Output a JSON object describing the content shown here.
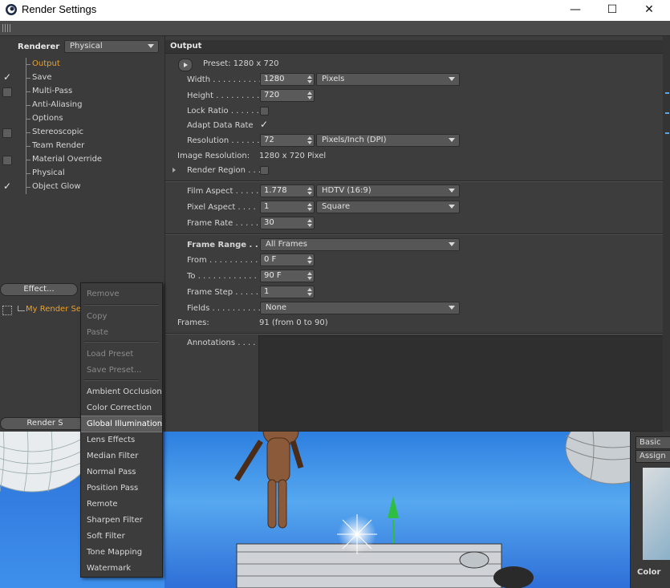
{
  "window": {
    "title": "Render Settings",
    "minimize": "—",
    "maximize": "☐",
    "close": "✕"
  },
  "left": {
    "renderer_label": "Renderer",
    "renderer_value": "Physical",
    "tree": [
      {
        "label": "Output",
        "check": "none",
        "active": true
      },
      {
        "label": "Save",
        "check": "tick",
        "active": false
      },
      {
        "label": "Multi-Pass",
        "check": "box",
        "active": false
      },
      {
        "label": "Anti-Aliasing",
        "check": "none",
        "active": false
      },
      {
        "label": "Options",
        "check": "none",
        "active": false
      },
      {
        "label": "Stereoscopic",
        "check": "box",
        "active": false
      },
      {
        "label": "Team Render",
        "check": "none",
        "active": false
      },
      {
        "label": "Material Override",
        "check": "box",
        "active": false
      },
      {
        "label": "Physical",
        "check": "none",
        "active": false
      },
      {
        "label": "Object Glow",
        "check": "tick",
        "active": false
      }
    ],
    "effect_button": "Effect...",
    "render_setting_name": "My Render Se",
    "render_setting_button": "Render S"
  },
  "output": {
    "header": "Output",
    "preset": "Preset: 1280 x 720",
    "width_label": "Width . . . . . . . . . .",
    "width_value": "1280",
    "width_unit": "Pixels",
    "height_label": "Height . . . . . . . . .",
    "height_value": "720",
    "lock_ratio_label": "Lock Ratio . . . . . .",
    "adapt_label": "Adapt Data Rate",
    "resolution_label": "Resolution . . . . . .",
    "resolution_value": "72",
    "resolution_unit": "Pixels/Inch (DPI)",
    "image_res_label": "Image Resolution:",
    "image_res_value": "1280 x 720 Pixel",
    "render_region_label": "Render Region . . .",
    "film_aspect_label": "Film Aspect . . . . .",
    "film_aspect_value": "1.778",
    "film_aspect_preset": "HDTV (16:9)",
    "pixel_aspect_label": "Pixel Aspect . . . .",
    "pixel_aspect_value": "1",
    "pixel_aspect_preset": "Square",
    "frame_rate_label": "Frame Rate . . . . . .",
    "frame_rate_value": "30",
    "frame_range_label": "Frame Range . .",
    "frame_range_value": "All Frames",
    "from_label": "From . . . . . . . . . . .",
    "from_value": "0 F",
    "to_label": "To . . . . . . . . . . . . .",
    "to_value": "90 F",
    "frame_step_label": "Frame Step . . . . .",
    "frame_step_value": "1",
    "fields_label": "Fields . . . . . . . . . .",
    "fields_value": "None",
    "frames_label": "Frames:",
    "frames_value": "91 (from 0 to 90)",
    "annotations_label": "Annotations . . . ."
  },
  "popup": {
    "items": [
      {
        "label": "Remove",
        "state": "dis"
      },
      {
        "label": "Copy",
        "state": "dis"
      },
      {
        "label": "Paste",
        "state": "dis"
      },
      {
        "label": "Load Preset",
        "state": "dis"
      },
      {
        "label": "Save Preset...",
        "state": "dis"
      },
      {
        "label": "Ambient Occlusion",
        "state": "en"
      },
      {
        "label": "Color Correction",
        "state": "en"
      },
      {
        "label": "Global Illumination",
        "state": "hl"
      },
      {
        "label": "Lens Effects",
        "state": "en"
      },
      {
        "label": "Median Filter",
        "state": "en"
      },
      {
        "label": "Normal Pass",
        "state": "en"
      },
      {
        "label": "Position Pass",
        "state": "en"
      },
      {
        "label": "Remote",
        "state": "en"
      },
      {
        "label": "Sharpen Filter",
        "state": "en"
      },
      {
        "label": "Soft Filter",
        "state": "en"
      },
      {
        "label": "Tone Mapping",
        "state": "en"
      },
      {
        "label": "Watermark",
        "state": "en"
      }
    ]
  },
  "right": {
    "tab_basic": "Basic",
    "tab_assign": "Assign",
    "color_label": "Color"
  },
  "colors": {
    "accent": "#f0a020",
    "panel": "#3d3d3d",
    "viewport_sky": "#4aa0ee"
  }
}
